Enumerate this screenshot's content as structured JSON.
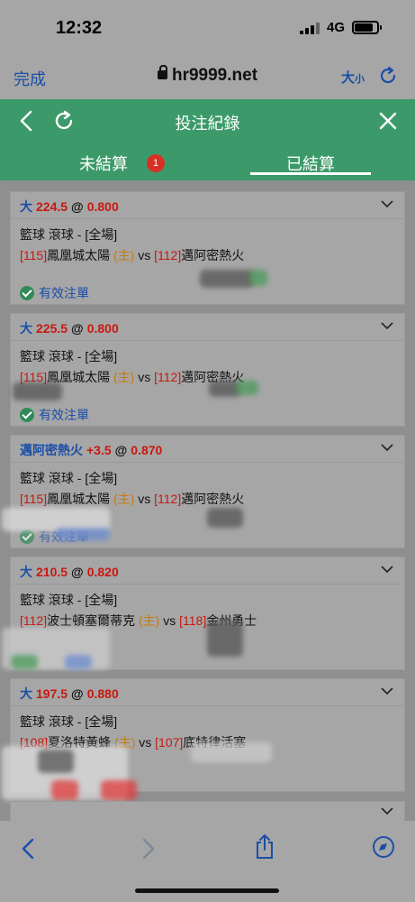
{
  "status_bar": {
    "time": "12:32",
    "network": "4G"
  },
  "browser": {
    "done": "完成",
    "url": "hr9999.net",
    "text_size_main": "大",
    "text_size_small": "小"
  },
  "header": {
    "title": "投注紀錄"
  },
  "tabs": {
    "pending": "未結算",
    "pending_badge": "1",
    "settled": "已結算"
  },
  "bets": [
    {
      "selection": "大",
      "line": "224.5",
      "at": "@",
      "odds": "0.800",
      "sport": "籃球 滾球 - [全場]",
      "home_id": "[115]",
      "home_team": "鳳凰城太陽",
      "home_tag": "(主)",
      "vs": "vs",
      "away_id": "[112]",
      "away_team": "邁阿密熱火",
      "status": "有效注單"
    },
    {
      "selection": "大",
      "line": "225.5",
      "at": "@",
      "odds": "0.800",
      "sport": "籃球 滾球 - [全場]",
      "home_id": "[115]",
      "home_team": "鳳凰城太陽",
      "home_tag": "(主)",
      "vs": "vs",
      "away_id": "[112]",
      "away_team": "邁阿密熱火",
      "status": "有效注單"
    },
    {
      "selection": "邁阿密熱火",
      "line": "+3.5",
      "at": "@",
      "odds": "0.870",
      "sport": "籃球 滾球 - [全場]",
      "home_id": "[115]",
      "home_team": "鳳凰城太陽",
      "home_tag": "(主)",
      "vs": "vs",
      "away_id": "[112]",
      "away_team": "邁阿密熱火",
      "status": "有效注單"
    },
    {
      "selection": "大",
      "line": "210.5",
      "at": "@",
      "odds": "0.820",
      "sport": "籃球 滾球 - [全場]",
      "home_id": "[112]",
      "home_team": "波士頓塞爾蒂克",
      "home_tag": "(主)",
      "vs": "vs",
      "away_id": "[118]",
      "away_team": "金州勇士"
    },
    {
      "selection": "大",
      "line": "197.5",
      "at": "@",
      "odds": "0.880",
      "sport": "籃球 滾球 - [全場]",
      "home_id": "[108]",
      "home_team": "夏洛特黃蜂",
      "home_tag": "(主)",
      "vs": "vs",
      "away_id": "[107]",
      "away_team": "底特律活塞"
    }
  ],
  "colors": {
    "header_green": "#3c9a6a",
    "link_blue": "#1a4ea8",
    "odds_red": "#c8180f",
    "home_orange": "#c97a0a"
  },
  "icons": [
    "lock-icon",
    "reload-icon",
    "back-chevron-icon",
    "refresh-icon",
    "close-icon",
    "chevron-down-icon",
    "check-circle-icon",
    "share-icon",
    "compass-icon"
  ]
}
